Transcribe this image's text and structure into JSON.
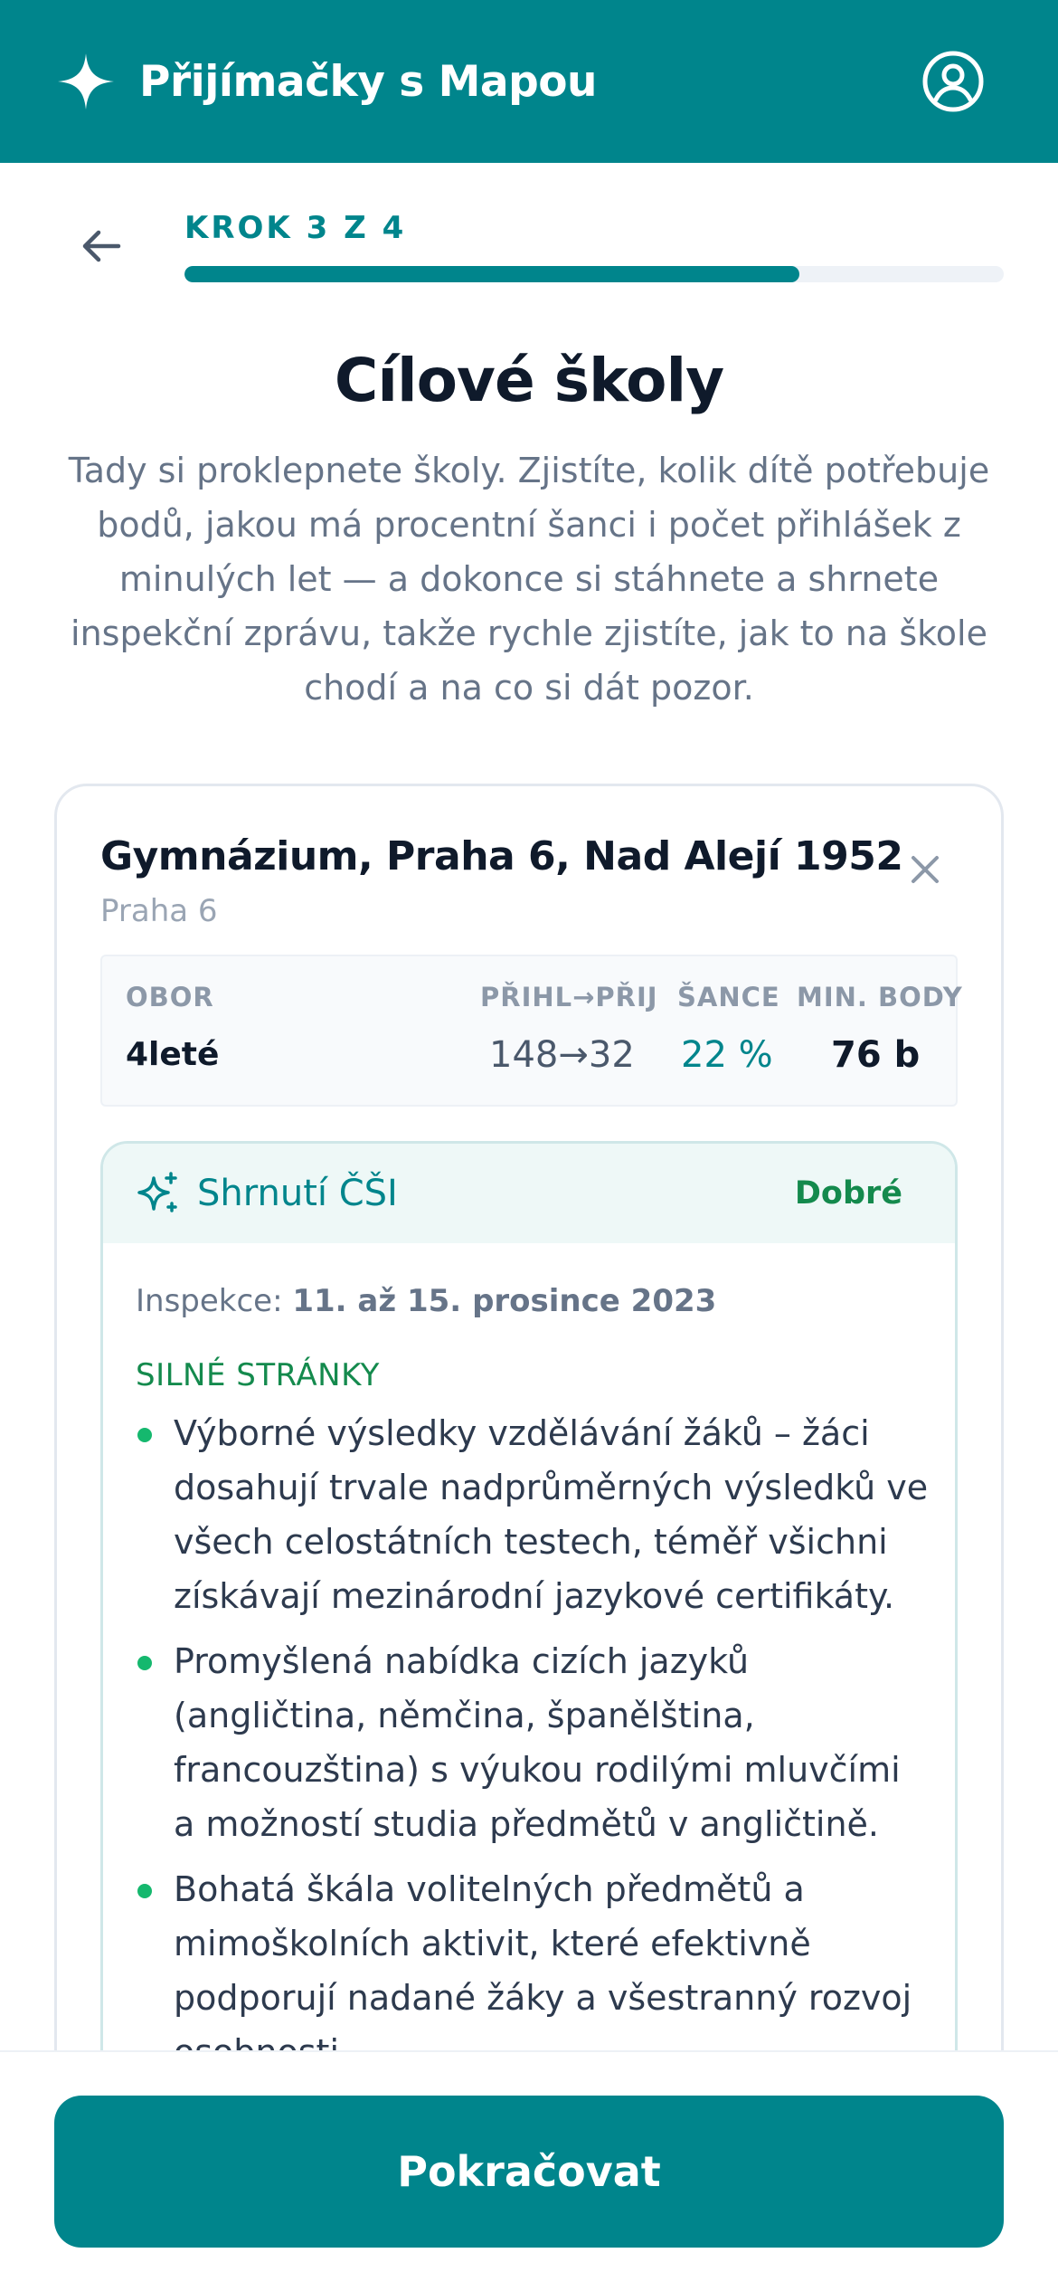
{
  "app": {
    "title": "Přijímačky s Mapou",
    "brand_icon": "sparkle-icon",
    "account_icon": "user-circle-icon"
  },
  "colors": {
    "brand": "#00858c",
    "rating_good": "#148a4d",
    "bullet": "#15b86e"
  },
  "step": {
    "label": "KROK 3 Z 4",
    "current": 3,
    "total": 4,
    "progress_fraction": 0.75,
    "back_icon": "arrow-left-icon"
  },
  "page": {
    "title": "Cílové školy",
    "description": "Tady si proklepnete školy. Zjistíte, kolik dítě potřebuje bodů, jakou má procentní šanci i počet přihlášek z minulých let — a dokonce si stáhnete a shrnete inspekční zprávu, takže rychle zjistíte, jak to na škole chodí a na co si dát pozor."
  },
  "school": {
    "name": "Gymnázium, Praha 6, Nad Alejí 1952",
    "city": "Praha 6",
    "close_icon": "close-icon",
    "table": {
      "headers": {
        "program": "OBOR",
        "applied": "PŘIHL→PŘIJ",
        "chance": "ŠANCE",
        "min_points": "MIN. BODY"
      },
      "row": {
        "program": "4leté",
        "applied": "148→32",
        "chance": "22 %",
        "min_points": "76 b"
      }
    },
    "csi": {
      "icon": "sparkles-icon",
      "title": "Shrnutí ČŠI",
      "rating": "Dobré",
      "inspection_label": "Inspekce:",
      "inspection_date": "11. až 15. prosince 2023",
      "strengths_heading": "SILNÉ STRÁNKY",
      "strengths": [
        "Výborné výsledky vzdělávání žáků – žáci dosahují trvale nadprůměrných výsledků ve všech celostátních testech, téměř všichni získávají mezinárodní jazykové certifikáty.",
        "Promyšlená nabídka cizích jazyků (angličtina, němčina, španělština, francouzština) s výukou rodilými mluvčími a možností studia předmětů v angličtině.",
        "Bohatá škála volitelných předmětů a mimoškolních aktivit, které efektivně podporují nadané žáky a všestranný rozvoj osobnosti."
      ]
    }
  },
  "footer": {
    "continue_label": "Pokračovat"
  }
}
